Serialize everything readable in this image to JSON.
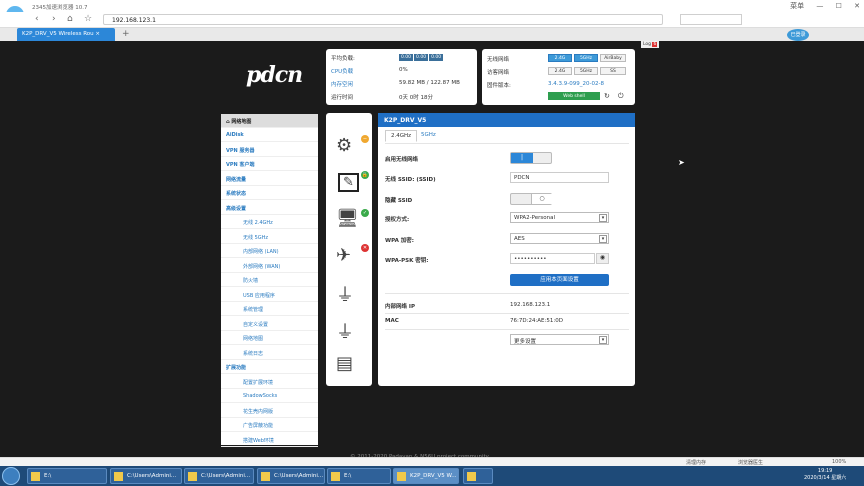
{
  "browser": {
    "title": "2345加速浏览器 10.7",
    "url": "192.168.123.1",
    "tab_title": "K2P_DRV_V5 Wireless Rou",
    "window_controls": [
      "菜单",
      "—",
      "☐",
      "✕"
    ],
    "user_badge": "已登录"
  },
  "router": {
    "brand": "pdcn",
    "log_label": "Log",
    "log_count": "6",
    "system": {
      "load_label": "平均负载:",
      "load_values": [
        "0.00",
        "0.00",
        "0.00"
      ],
      "cpu_label": "CPU负载",
      "cpu_value": "0%",
      "mem_label": "内存空闲",
      "mem_value": "59.82 MB / 122.87 MB",
      "uptime_label": "运行时间",
      "uptime_value": "0天 0时 18分"
    },
    "wireless_status": {
      "wifi_label": "无线网络",
      "wifi_buttons": [
        "2.4G",
        "5GHz",
        "AirBaby"
      ],
      "guest_label": "访客网络",
      "guest_buttons": [
        "2.4G",
        "5GHz",
        "SS"
      ],
      "firmware_label": "固件版本:",
      "firmware_value": "3.4.3.9-099_20-02-8",
      "webshell_button": "Web shell"
    },
    "sidebar": {
      "header": "网络地图",
      "items": [
        {
          "label": "AiDisk",
          "type": "sec"
        },
        {
          "label": "VPN 服务器",
          "type": "sec"
        },
        {
          "label": "VPN 客户端",
          "type": "sec"
        },
        {
          "label": "网络流量",
          "type": "sec"
        },
        {
          "label": "系统状态",
          "type": "sec"
        },
        {
          "label": "高级设置",
          "type": "sec"
        },
        {
          "label": "无线 2.4GHz",
          "type": "sub"
        },
        {
          "label": "无线 5GHz",
          "type": "sub"
        },
        {
          "label": "内部网络 (LAN)",
          "type": "sub"
        },
        {
          "label": "外部网络 (WAN)",
          "type": "sub"
        },
        {
          "label": "防火墙",
          "type": "sub"
        },
        {
          "label": "USB 应用程序",
          "type": "sub"
        },
        {
          "label": "系统管理",
          "type": "sub"
        },
        {
          "label": "自定义设置",
          "type": "sub"
        },
        {
          "label": "网络地图",
          "type": "sub"
        },
        {
          "label": "系统日志",
          "type": "sub"
        },
        {
          "label": "扩展功能",
          "type": "sec"
        },
        {
          "label": "配置扩展环境",
          "type": "sub"
        },
        {
          "label": "ShadowSocks",
          "type": "sub"
        },
        {
          "label": "花生壳内网版",
          "type": "sub"
        },
        {
          "label": "广告屏蔽功能",
          "type": "sub"
        },
        {
          "label": "搭建Web环境",
          "type": "sub"
        }
      ]
    },
    "panel": {
      "title": "K2P_DRV_V5",
      "tabs": [
        "2.4GHz",
        "5GHz"
      ],
      "enable_wifi_label": "启用无线网络",
      "ssid_label": "无线 SSID: (SSID)",
      "ssid_value": "PDCN",
      "hide_ssid_label": "隐藏 SSID",
      "auth_label": "授权方式:",
      "auth_value": "WPA2-Personal",
      "wpa_enc_label": "WPA 加密:",
      "wpa_enc_value": "AES",
      "psk_label": "WPA-PSK 密钥:",
      "psk_value": "••••••••••",
      "apply_button": "应用本页面设置",
      "lan_ip_label": "内部网络 IP",
      "lan_ip_value": "192.168.123.1",
      "mac_label": "MAC",
      "mac_value": "76:7D:24:AE:51:0D",
      "more_settings": "更多设置"
    },
    "footer": "© 2011-2020 Padavan & N56U project community"
  },
  "statusbar": {
    "items": [
      "清理内存",
      "浏览器医生",
      "100%"
    ]
  },
  "taskbar": {
    "buttons": [
      {
        "label": "E:\\",
        "active": false
      },
      {
        "label": "C:\\Users\\Admini...",
        "active": false
      },
      {
        "label": "C:\\Users\\Admini...",
        "active": false
      },
      {
        "label": "C:\\Users\\Admini...",
        "active": false
      },
      {
        "label": "E:\\",
        "active": false
      },
      {
        "label": "K2P_DRV_V5 W...",
        "active": true
      },
      {
        "label": "",
        "active": false
      }
    ],
    "time": "19:19",
    "date": "2020/3/14 星期六"
  },
  "colors": {
    "accent": "#1f6fc5",
    "page_bg": "#1b1b1b",
    "taskbar": "#1e4a78"
  }
}
